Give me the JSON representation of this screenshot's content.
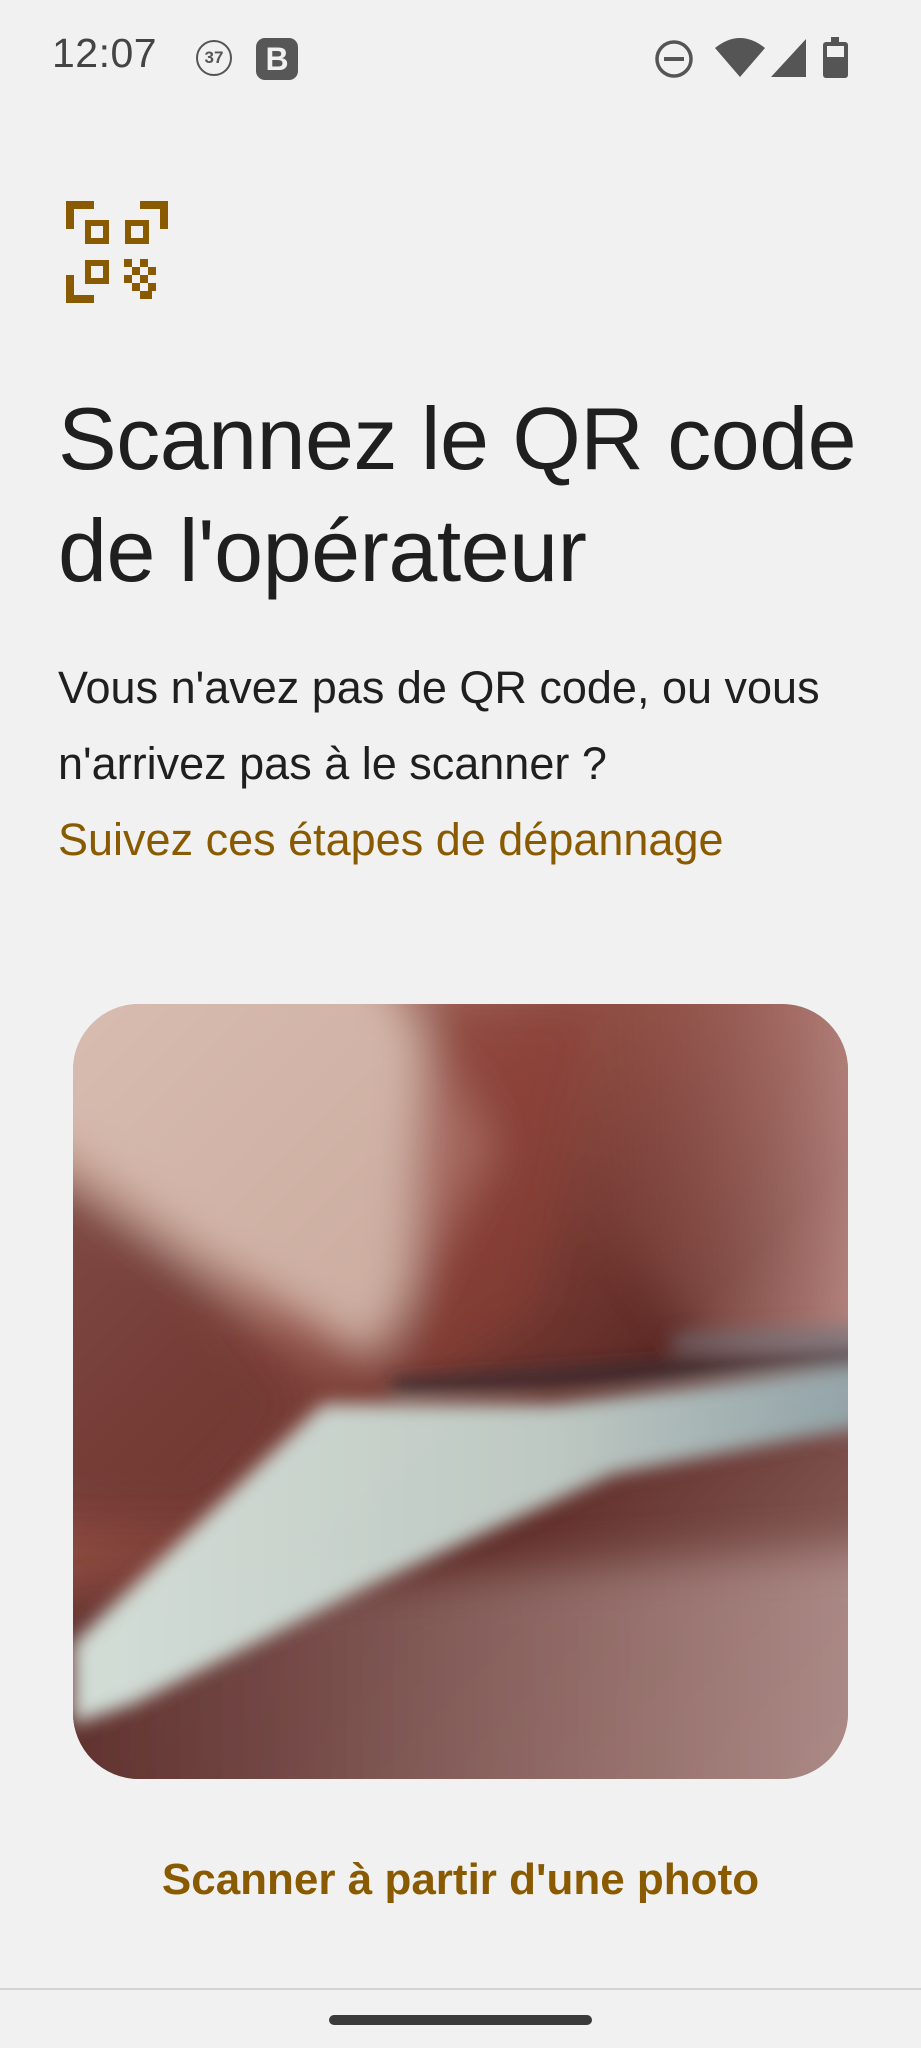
{
  "status_bar": {
    "time": "12:07",
    "notification_count": "37",
    "notification_letter": "B",
    "icons": [
      "do-not-disturb-icon",
      "wifi-icon",
      "signal-icon",
      "battery-icon"
    ]
  },
  "header": {
    "logo_icon": "qr-code-icon",
    "title": "Scannez le QR code de l'opérateur"
  },
  "help": {
    "text": "Vous n'avez pas de QR code, ou vous n'arrivez pas à le scanner ?",
    "link": "Suivez ces étapes de dépannage"
  },
  "camera": {
    "preview": "camera-viewfinder"
  },
  "actions": {
    "scan_from_photo": "Scanner à partir d'une photo"
  },
  "colors": {
    "accent": "#8a5a00",
    "background": "#f1f1f1",
    "text": "#1f1f1f"
  }
}
